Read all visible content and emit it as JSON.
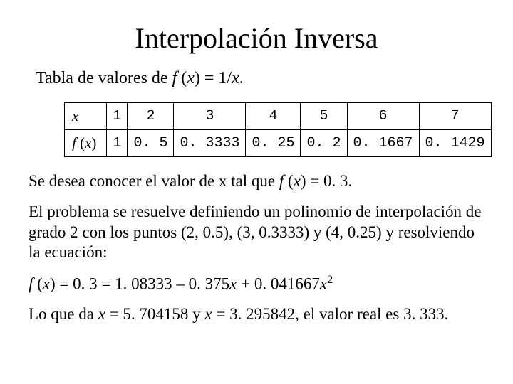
{
  "title": "Interpolación Inversa",
  "subtitle_prefix": "Tabla de valores de ",
  "subtitle_fn": "f ",
  "subtitle_paren_open": "(",
  "subtitle_x": "x",
  "subtitle_paren_close": ") = 1/",
  "subtitle_x2": "x",
  "subtitle_dot": ".",
  "row1_head": "x",
  "row2_head_f": "f ",
  "row2_head_open": "(",
  "row2_head_x": "x",
  "row2_head_close": ")",
  "xs": [
    "1",
    "2",
    "3",
    "4",
    "5",
    "6",
    "7"
  ],
  "fxs": [
    "1",
    "0. 5",
    "0. 3333",
    "0. 25",
    "0. 2",
    "0. 1667",
    "0. 1429"
  ],
  "p1_a": "Se desea conocer el valor de x tal que ",
  "p1_f": "f ",
  "p1_open": "(",
  "p1_x": "x",
  "p1_close": ") = 0. 3.",
  "p2": "El problema se resuelve definiendo un polinomio de interpolación de grado 2 con los puntos (2, 0.5), (3, 0.3333) y (4, 0.25) y resolviendo la ecuación:",
  "p3_f": "f ",
  "p3_open": "(",
  "p3_x": "x",
  "p3_mid": ") = 0. 3 = 1. 08333 – 0. 375",
  "p3_x2": "x",
  "p3_plus": " + 0. 041667",
  "p3_x3": "x",
  "p3_sq": "2",
  "p4_a": "Lo que da ",
  "p4_x1": "x",
  "p4_b": " = 5. 704158 y ",
  "p4_x2": "x",
  "p4_c": " = 3. 295842, el valor real es 3. 333.",
  "chart_data": {
    "type": "table",
    "title": "Tabla de valores de f(x) = 1/x",
    "columns": [
      "x",
      "f(x)"
    ],
    "rows": [
      [
        1,
        1
      ],
      [
        2,
        0.5
      ],
      [
        3,
        0.3333
      ],
      [
        4,
        0.25
      ],
      [
        5,
        0.2
      ],
      [
        6,
        0.1667
      ],
      [
        7,
        0.1429
      ]
    ]
  }
}
